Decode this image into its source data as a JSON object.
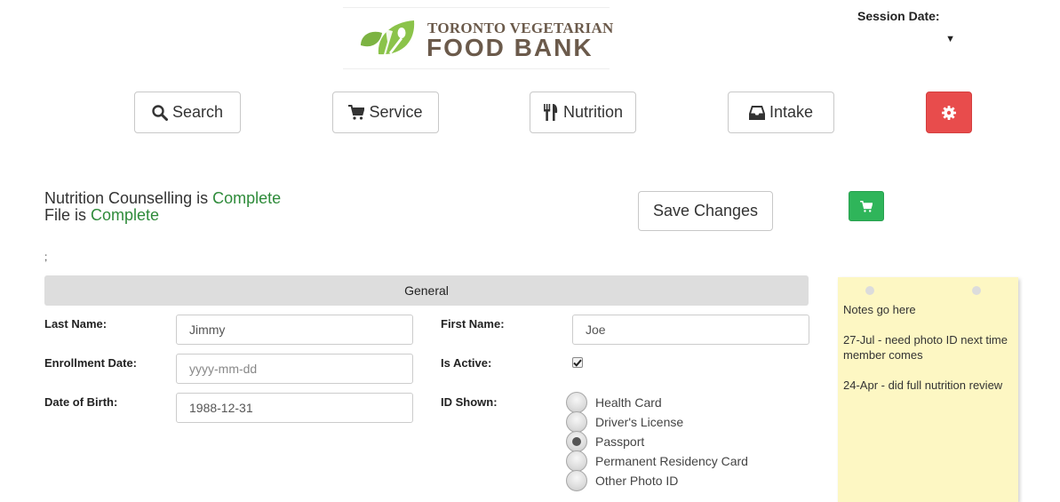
{
  "logo": {
    "line1": "TORONTO VEGETARIAN",
    "line2": "FOOD BANK"
  },
  "session": {
    "label": "Session Date:",
    "value": ""
  },
  "nav": {
    "search_label": "Search",
    "service_label": "Service",
    "nutrition_label": "Nutrition",
    "intake_label": "Intake"
  },
  "status": {
    "counselling_prefix": "Nutrition Counselling is ",
    "counselling_value": "Complete",
    "file_prefix": "File is ",
    "file_value": "Complete"
  },
  "actions": {
    "save_label": "Save Changes"
  },
  "stray_text": ";",
  "section": {
    "title": "General"
  },
  "form": {
    "last_name": {
      "label": "Last Name:",
      "value": "Jimmy"
    },
    "first_name": {
      "label": "First Name:",
      "value": "Joe"
    },
    "enrollment_date": {
      "label": "Enrollment Date:",
      "value": "",
      "placeholder": "yyyy-mm-dd"
    },
    "is_active": {
      "label": "Is Active:",
      "checked": true
    },
    "date_of_birth": {
      "label": "Date of Birth:",
      "value": "1988-12-31"
    },
    "id_shown": {
      "label": "ID Shown:",
      "options": [
        "Health Card",
        "Driver's License",
        "Passport",
        "Permanent Residency Card",
        "Other Photo ID"
      ],
      "selected": "Passport"
    }
  },
  "notes": {
    "lines": [
      "Notes go here",
      "27-Jul - need photo ID next time member comes",
      "24-Apr - did full nutrition review"
    ]
  },
  "colors": {
    "accent_green": "#2e8b3a",
    "danger": "#e84c4c",
    "success": "#2fb55a",
    "note_bg": "#fdf7c3"
  },
  "icons": [
    "logo-icon",
    "search-icon",
    "cart-icon",
    "utensils-icon",
    "inbox-icon",
    "gear-icon",
    "checkmark-icon",
    "caret-down-icon"
  ]
}
